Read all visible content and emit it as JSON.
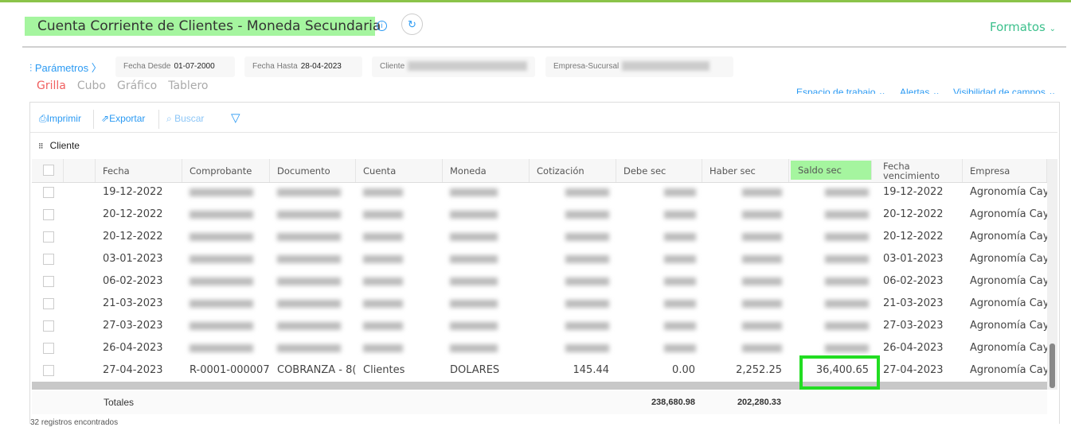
{
  "header": {
    "title": "Cuenta Corriente de Clientes - Moneda Secundaria",
    "formatos": "Formatos"
  },
  "params": {
    "label": "Parámetros",
    "fecha_desde_label": "Fecha Desde",
    "fecha_desde": "01-07-2000",
    "fecha_hasta_label": "Fecha Hasta",
    "fecha_hasta": "28-04-2023",
    "cliente_label": "Cliente",
    "empresa_label": "Empresa-Sucursal"
  },
  "views": [
    "Grilla",
    "Cubo",
    "Gráfico",
    "Tablero"
  ],
  "links": {
    "espacio": "Espacio de trabajo",
    "alertas": "Alertas",
    "visibilidad": "Visibilidad de campos"
  },
  "toolbar": {
    "imprimir": "Imprimir",
    "exportar": "Exportar",
    "buscar": "Buscar"
  },
  "group": "Cliente",
  "columns": [
    "Fecha",
    "Comprobante",
    "Documento",
    "Cuenta",
    "Moneda",
    "Cotización",
    "Debe sec",
    "Haber sec",
    "Saldo sec",
    "Fecha vencimiento",
    "Empresa"
  ],
  "rows": [
    {
      "fecha": "19-12-2022",
      "venc": "19-12-2022",
      "empresa": "Agronomía Cay"
    },
    {
      "fecha": "20-12-2022",
      "venc": "20-12-2022",
      "empresa": "Agronomía Cay"
    },
    {
      "fecha": "20-12-2022",
      "venc": "20-12-2022",
      "empresa": "Agronomía Cay"
    },
    {
      "fecha": "03-01-2023",
      "venc": "03-01-2023",
      "empresa": "Agronomía Cay"
    },
    {
      "fecha": "06-02-2023",
      "venc": "06-02-2023",
      "empresa": "Agronomía Cay"
    },
    {
      "fecha": "21-03-2023",
      "venc": "21-03-2023",
      "empresa": "Agronomía Cay"
    },
    {
      "fecha": "27-03-2023",
      "venc": "27-03-2023",
      "empresa": "Agronomía Cay"
    },
    {
      "fecha": "26-04-2023",
      "venc": "26-04-2023",
      "empresa": "Agronomía Cay"
    }
  ],
  "last_row": {
    "fecha": "27-04-2023",
    "comprobante": "R-0001-000007",
    "documento": "COBRANZA - 8(",
    "cuenta": "Clientes",
    "moneda": "DOLARES",
    "cotizacion": "145.44",
    "debe": "0.00",
    "haber": "2,252.25",
    "saldo": "36,400.65",
    "venc": "27-04-2023",
    "empresa": "Agronomía Cay"
  },
  "totals": {
    "label": "Totales",
    "debe": "238,680.98",
    "haber": "202,280.33"
  },
  "footer": "32 registros encontrados"
}
